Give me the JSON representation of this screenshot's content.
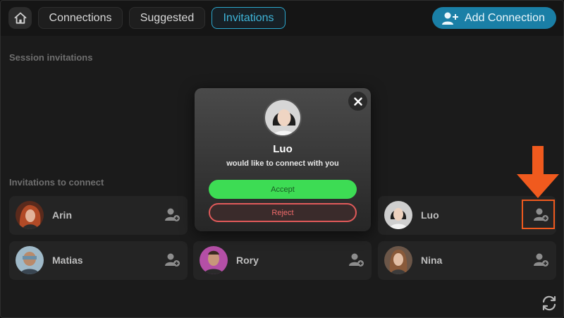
{
  "topbar": {
    "tabs": [
      {
        "label": "Connections"
      },
      {
        "label": "Suggested"
      },
      {
        "label": "Invitations"
      }
    ],
    "add_connection_label": "Add Connection"
  },
  "sections": {
    "session_invitations": "Session invitations",
    "invitations_to_connect": "Invitations to connect"
  },
  "invitations": [
    {
      "name": "Arin"
    },
    {
      "name": "Luo"
    },
    {
      "name": "Matias"
    },
    {
      "name": "Rory"
    },
    {
      "name": "Nina"
    }
  ],
  "modal": {
    "name": "Luo",
    "message": "would like to connect with you",
    "accept_label": "Accept",
    "reject_label": "Reject"
  },
  "colors": {
    "accent": "#2ca6cc",
    "accept": "#3ddc54",
    "reject": "#e05a5a",
    "annotation": "#f05a1e"
  }
}
